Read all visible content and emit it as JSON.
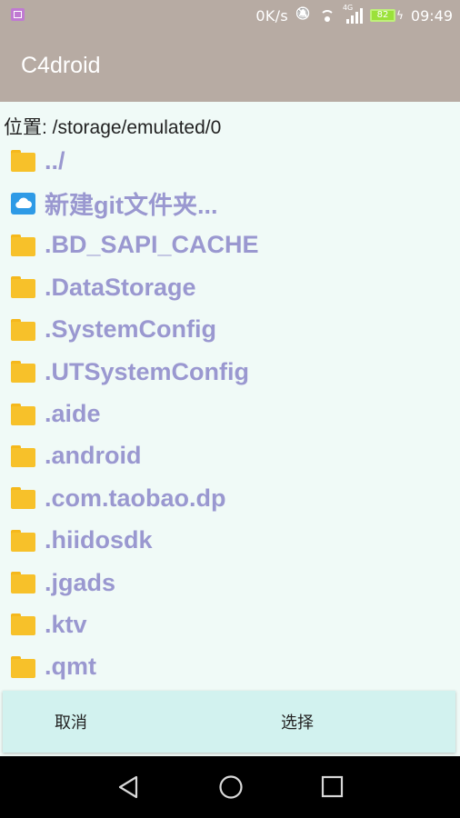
{
  "status_bar": {
    "speed": "0K/s",
    "signal_label": "4G",
    "battery": "82",
    "time": "09:49"
  },
  "app_bar": {
    "title": "C4droid"
  },
  "location": {
    "text": "位置: /storage/emulated/0"
  },
  "files": [
    {
      "name": "../",
      "icon": "folder-icon"
    },
    {
      "name": "新建git文件夹...",
      "icon": "cloud-icon"
    },
    {
      "name": ".BD_SAPI_CACHE",
      "icon": "folder-icon"
    },
    {
      "name": ".DataStorage",
      "icon": "folder-icon"
    },
    {
      "name": ".SystemConfig",
      "icon": "folder-icon"
    },
    {
      "name": ".UTSystemConfig",
      "icon": "folder-icon"
    },
    {
      "name": ".aide",
      "icon": "folder-icon"
    },
    {
      "name": ".android",
      "icon": "folder-icon"
    },
    {
      "name": ".com.taobao.dp",
      "icon": "folder-icon"
    },
    {
      "name": ".hiidosdk",
      "icon": "folder-icon"
    },
    {
      "name": ".jgads",
      "icon": "folder-icon"
    },
    {
      "name": ".ktv",
      "icon": "folder-icon"
    },
    {
      "name": ".qmt",
      "icon": "folder-icon"
    }
  ],
  "buttons": {
    "cancel": "取消",
    "select": "选择"
  },
  "colors": {
    "app_bar": "#b7aba3",
    "content_bg": "#f0faf7",
    "file_name": "#9a98d0",
    "folder": "#f7c12a",
    "button_bar": "#d2f2ef"
  }
}
